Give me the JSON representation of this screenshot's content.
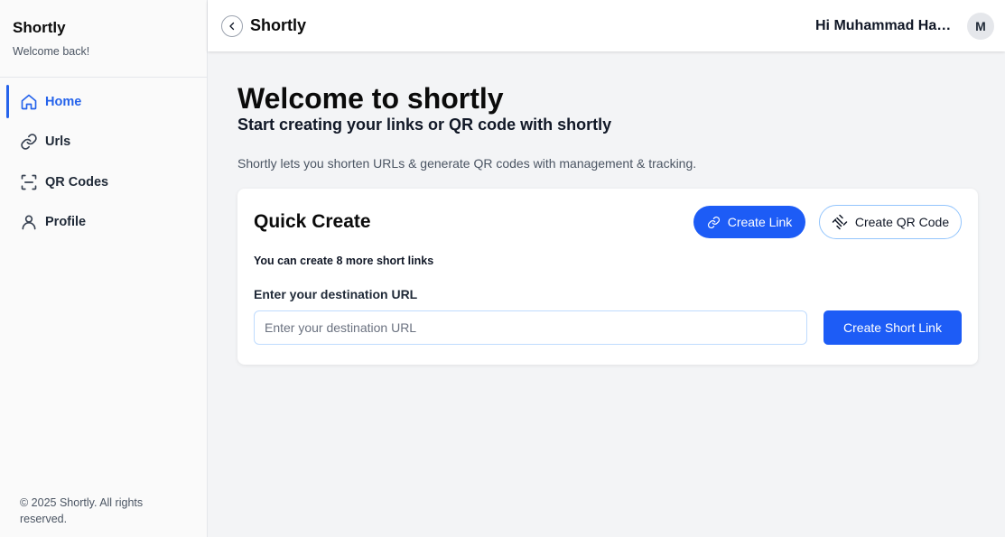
{
  "sidebar": {
    "brand": "Shortly",
    "subtitle": "Welcome back!",
    "items": [
      {
        "label": "Home",
        "icon": "home-icon",
        "active": true
      },
      {
        "label": "Urls",
        "icon": "link-icon",
        "active": false
      },
      {
        "label": "QR Codes",
        "icon": "qr-scan-icon",
        "active": false
      },
      {
        "label": "Profile",
        "icon": "user-icon",
        "active": false
      }
    ],
    "footer": "© 2025 Shortly. All rights reserved."
  },
  "header": {
    "title": "Shortly",
    "back_icon": "chevron-left-icon",
    "greeting": "Hi Muhammad Hassan",
    "avatar_initial": "M"
  },
  "main": {
    "heading": "Welcome to shortly",
    "subheading": "Start creating your links or QR code with shortly",
    "description": "Shortly lets you shorten URLs & generate QR codes with management & tracking."
  },
  "quick_create": {
    "title": "Quick Create",
    "create_link_label": "Create Link",
    "create_qr_label": "Create QR Code",
    "limit_text": "You can create 8 more short links",
    "field_label": "Enter your destination URL",
    "input_placeholder": "Enter your destination URL",
    "input_value": "",
    "submit_label": "Create Short Link"
  },
  "colors": {
    "accent": "#1d5cf6",
    "active_nav": "#2563eb",
    "background": "#f3f4f6"
  }
}
